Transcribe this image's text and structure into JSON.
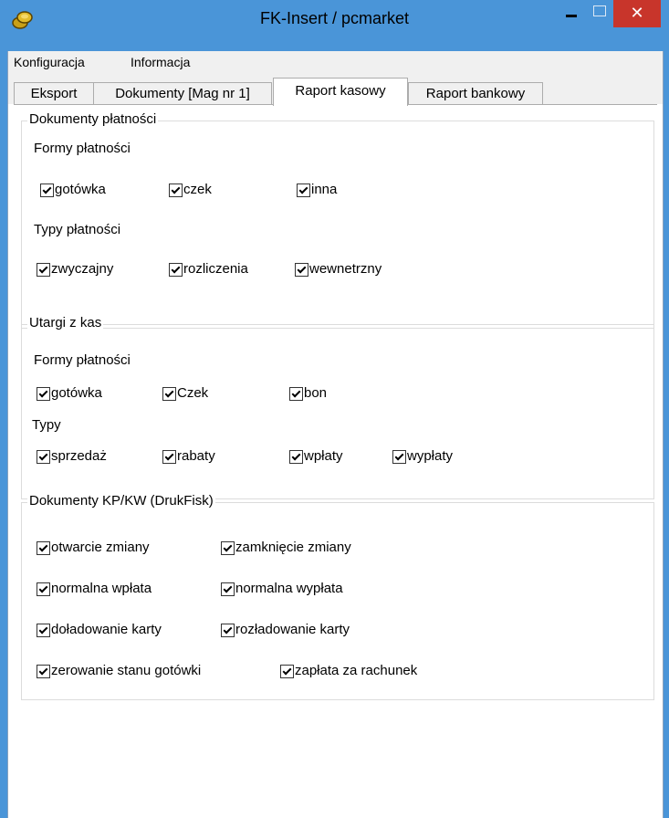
{
  "window": {
    "title": "FK-Insert  / pcmarket",
    "close_glyph": "✕",
    "icon": "coins-icon"
  },
  "menu": {
    "items": [
      "Konfiguracja",
      "Informacja"
    ]
  },
  "tabs": [
    "Eksport",
    "Dokumenty [Mag nr 1]",
    "Raport kasowy",
    "Raport bankowy"
  ],
  "active_tab": "Raport kasowy",
  "groups": {
    "dokumenty_platnosci": {
      "title": "Dokumenty płatności",
      "formy_label": "Formy płatności",
      "formy": [
        {
          "label": "gotówka",
          "checked": true
        },
        {
          "label": "czek",
          "checked": true
        },
        {
          "label": "inna",
          "checked": true
        }
      ],
      "typy_label": "Typy płatności",
      "typy": [
        {
          "label": "zwyczajny",
          "checked": true
        },
        {
          "label": "rozliczenia",
          "checked": true
        },
        {
          "label": "wewnetrzny",
          "checked": true
        }
      ]
    },
    "utargi": {
      "title": "Utargi z kas",
      "formy_label": "Formy płatności",
      "formy": [
        {
          "label": "gotówka",
          "checked": true
        },
        {
          "label": "Czek",
          "checked": true
        },
        {
          "label": "bon",
          "checked": true
        }
      ],
      "typy_label": "Typy",
      "typy": [
        {
          "label": "sprzedaż",
          "checked": true
        },
        {
          "label": "rabaty",
          "checked": true
        },
        {
          "label": "wpłaty",
          "checked": true
        },
        {
          "label": "wypłaty",
          "checked": true
        }
      ]
    },
    "kpkw": {
      "title": "Dokumenty KP/KW (DrukFisk)",
      "items": [
        {
          "label": "otwarcie zmiany",
          "checked": true
        },
        {
          "label": "zamknięcie zmiany",
          "checked": true
        },
        {
          "label": "normalna wpłata",
          "checked": true
        },
        {
          "label": "normalna wypłata",
          "checked": true
        },
        {
          "label": "doładowanie karty",
          "checked": true
        },
        {
          "label": "rozładowanie karty",
          "checked": true
        },
        {
          "label": "zerowanie stanu gotówki",
          "checked": true
        },
        {
          "label": "zapłata za rachunek",
          "checked": true
        }
      ]
    }
  },
  "colors": {
    "titlebar": "#4a95d8",
    "close": "#c8352b",
    "panel": "#f0f0f0"
  }
}
